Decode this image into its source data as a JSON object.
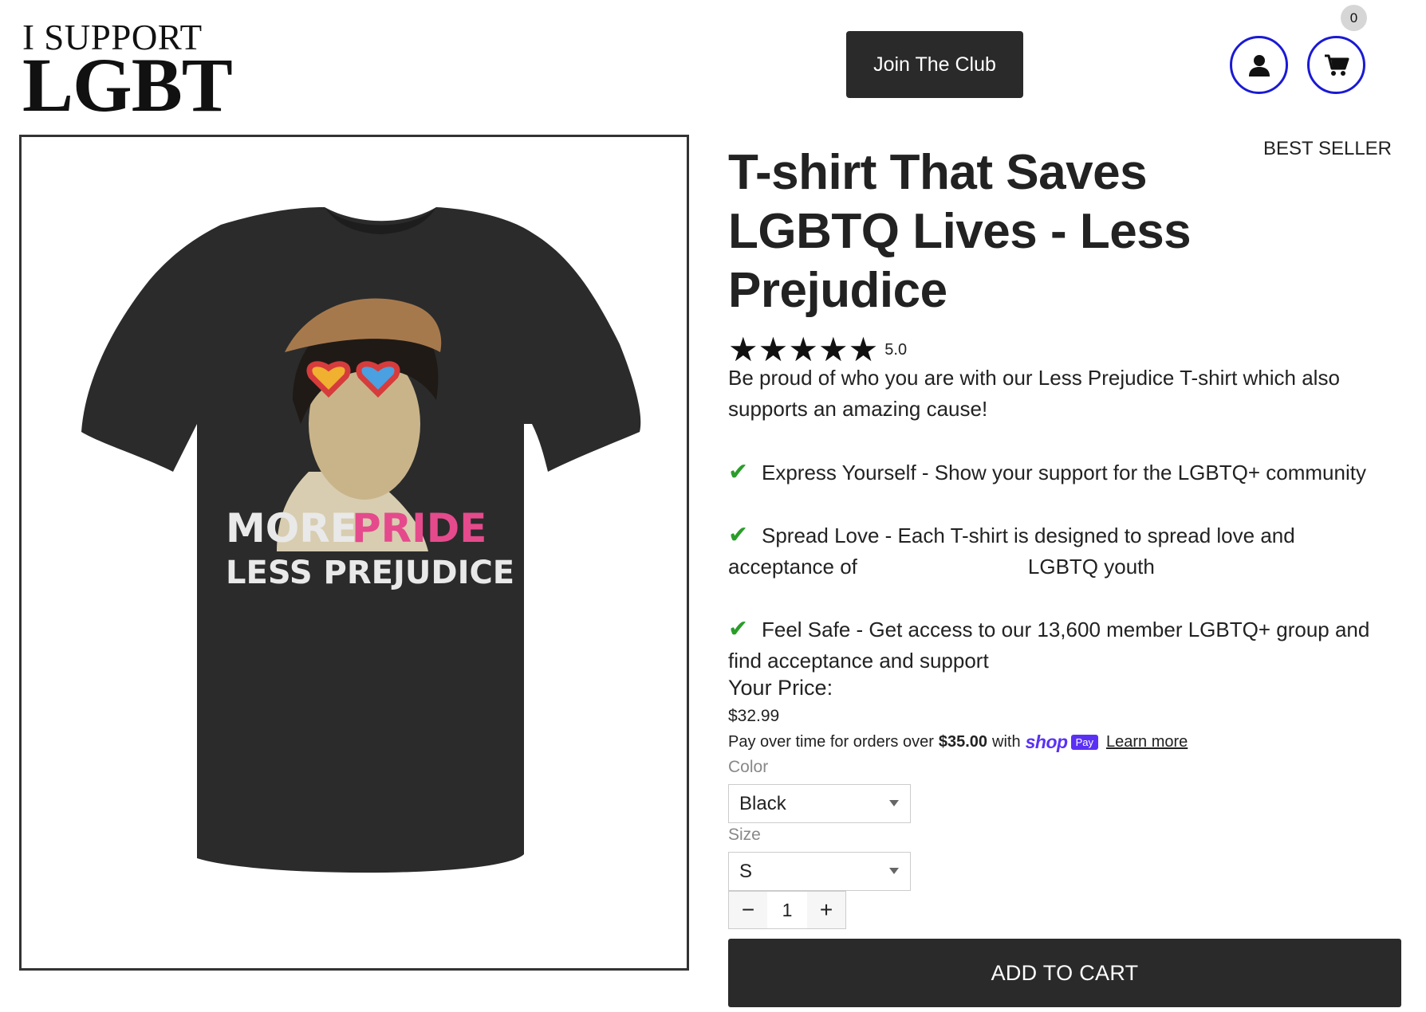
{
  "header": {
    "logo_line1": "I SUPPORT",
    "logo_line2": "LGBT",
    "join_club_label": "Join The Club",
    "cart_count": "0",
    "account_icon": "user-icon",
    "cart_icon": "cart-icon"
  },
  "product": {
    "badge": "BEST SELLER",
    "title": "T-shirt That Saves LGBTQ Lives - Less Prejudice",
    "rating_value": "5.0",
    "rating_stars": 5,
    "description": "Be proud of who you are with our Less Prejudice T-shirt which also supports an amazing cause!",
    "features": [
      {
        "text": "Express Yourself - Show your support for the LGBTQ+ community"
      },
      {
        "text_before": "Spread Love - Each T-shirt is designed to spread love and acceptance of",
        "text_after": "LGBTQ youth"
      },
      {
        "text": "Feel Safe - Get access to our 13,600 member LGBTQ+ group  and find acceptance and support"
      }
    ],
    "image": {
      "shirt_color": "#2b2b2b",
      "print_line1_a": "MORE",
      "print_line1_b": "PRIDE",
      "print_line2": "LESS PREJUDICE"
    }
  },
  "pricing": {
    "label": "Your Price:",
    "price": "$32.99",
    "shoppay_prefix": "Pay over time for orders over",
    "shoppay_amount": "$35.00",
    "shoppay_with": "with",
    "shoppay_brand": "shop",
    "shoppay_badge": "Pay",
    "learn_more": "Learn more"
  },
  "options": {
    "color_label": "Color",
    "color_value": "Black",
    "size_label": "Size",
    "size_value": "S",
    "quantity": "1"
  },
  "cta": {
    "add_to_cart": "ADD TO CART"
  },
  "colors": {
    "accent_circle": "#1a1ad4",
    "dark_button": "#2a2a2a",
    "check_green": "#2a9d2a",
    "shoppay_purple": "#5a31f4"
  }
}
